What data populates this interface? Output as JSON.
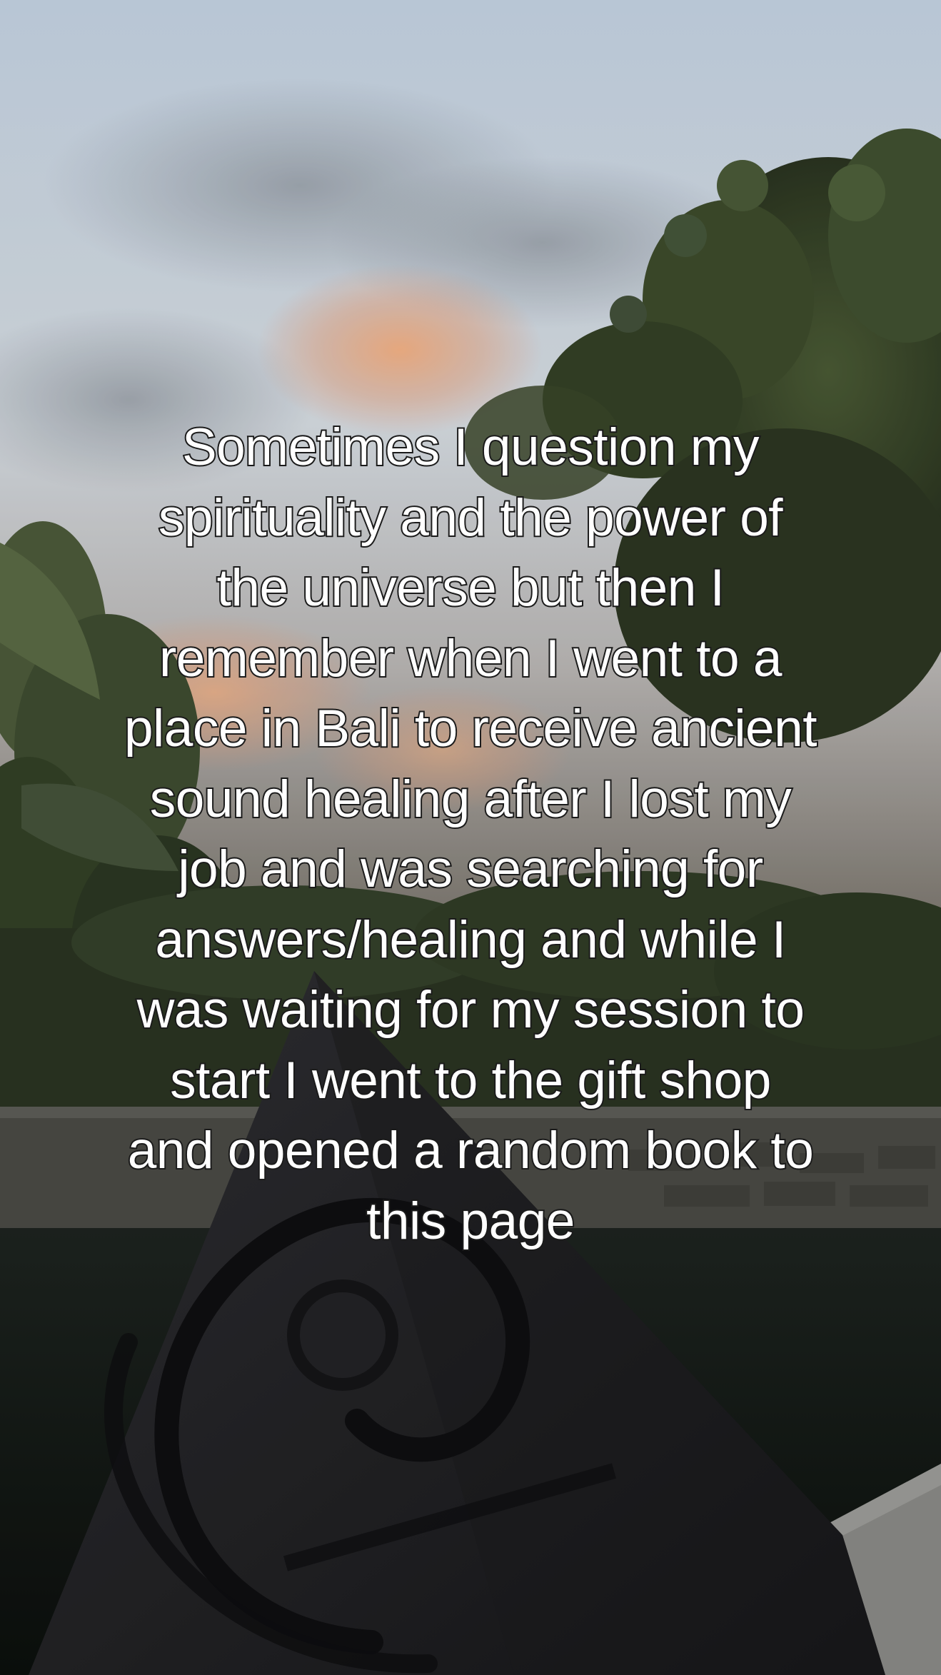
{
  "caption": {
    "lines": [
      "Sometimes I question my",
      "spirituality and the power of",
      "the universe but then I",
      "remember when I went to a",
      "place in Bali to receive ancient",
      "sound healing after I lost my",
      "job and was searching for",
      "answers/healing and while I",
      "was waiting for my session to",
      "start I went to the gift shop",
      "and opened a random book to",
      "this page"
    ]
  },
  "scene": {
    "sky_color": "#c9d6e2",
    "sunset_glow_color": "#f2a877",
    "foliage_color": "#3b4a2c",
    "sculpture_color": "#1f1f21",
    "water_color": "#0e1410"
  }
}
